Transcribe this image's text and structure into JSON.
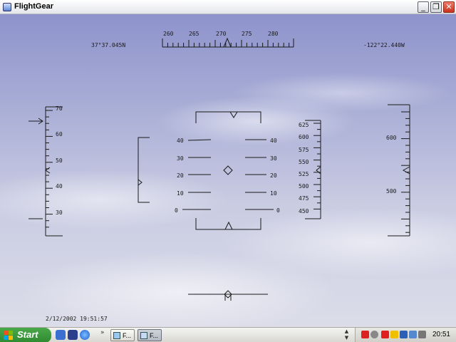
{
  "window": {
    "title": "FlightGear",
    "minimize_glyph": "_",
    "maximize_glyph": "❐",
    "close_glyph": "✕"
  },
  "hud": {
    "latitude": "37°37.045N",
    "longitude": "-122°22.440W",
    "datetime": "2/12/2002 19:51:57",
    "heading_ticks": [
      "260",
      "265",
      "270",
      "275",
      "280"
    ],
    "left_tape_ticks": [
      "70",
      "60",
      "50",
      "40",
      "30"
    ],
    "pitch_left": [
      "40",
      "30",
      "20",
      "10",
      "0"
    ],
    "pitch_right": [
      "40",
      "30",
      "20",
      "10",
      "0"
    ],
    "altitude_ticks": [
      "625",
      "600",
      "575",
      "550",
      "525",
      "500",
      "475",
      "450"
    ],
    "right_tape_ticks": [
      "600",
      "500"
    ],
    "color": "#1a1a1a"
  },
  "taskbar": {
    "start_label": "Start",
    "overflow_glyph": "»",
    "task_buttons": [
      {
        "label": "F..."
      },
      {
        "label": "F..."
      }
    ],
    "scroll_up": "▲",
    "scroll_down": "▼",
    "clock": "20:51",
    "colors": {
      "start_green": "#3a9a3a",
      "xp_blue": "#2a5fbf"
    }
  }
}
